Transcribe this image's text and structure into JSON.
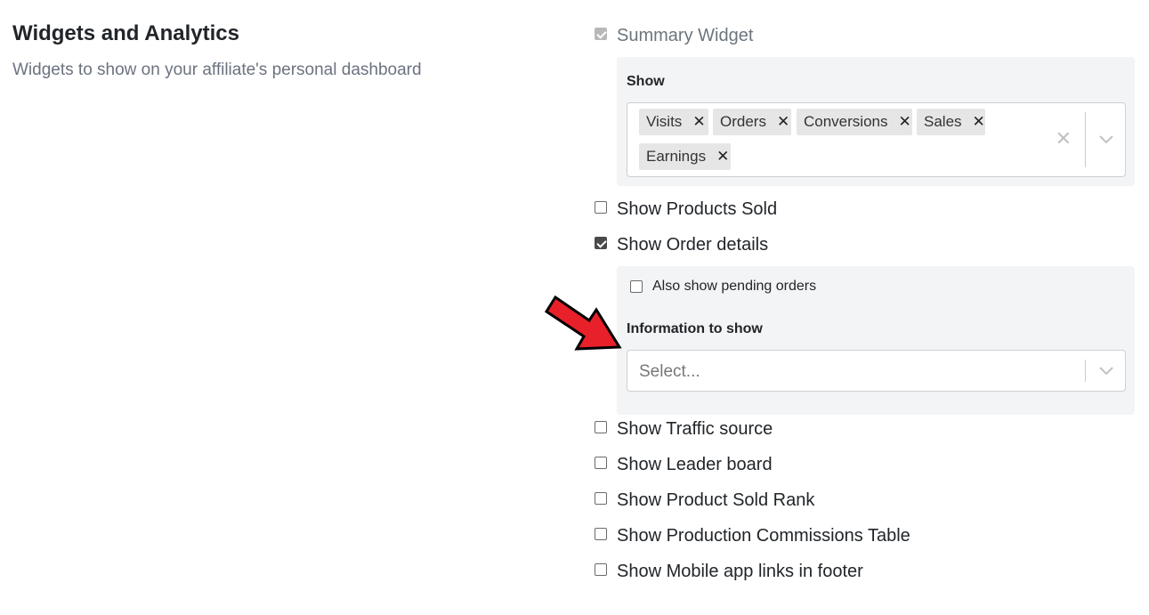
{
  "section": {
    "title": "Widgets and Analytics",
    "description": "Widgets to show on your affiliate's personal dashboard"
  },
  "summary_widget": {
    "label": "Summary Widget",
    "checked": true,
    "disabled": true,
    "show_label": "Show",
    "chips": [
      "Visits",
      "Orders",
      "Conversions",
      "Sales",
      "Earnings"
    ],
    "clear_icon": "close-icon",
    "dropdown_icon": "chevron-down-icon"
  },
  "options": {
    "products_sold": "Show Products Sold",
    "order_details": "Show Order details",
    "traffic_source": "Show Traffic source",
    "leader_board": "Show Leader board",
    "product_sold_rank": "Show Product Sold Rank",
    "production_commissions": "Show Production Commissions Table",
    "mobile_app_links": "Show Mobile app links in footer"
  },
  "order_details_panel": {
    "pending_label": "Also show pending orders",
    "info_label": "Information to show",
    "select_placeholder": "Select..."
  },
  "colors": {
    "panel_bg": "#f3f4f6",
    "chip_bg": "#e6e6e6",
    "annotation_arrow": "#e8202a"
  }
}
